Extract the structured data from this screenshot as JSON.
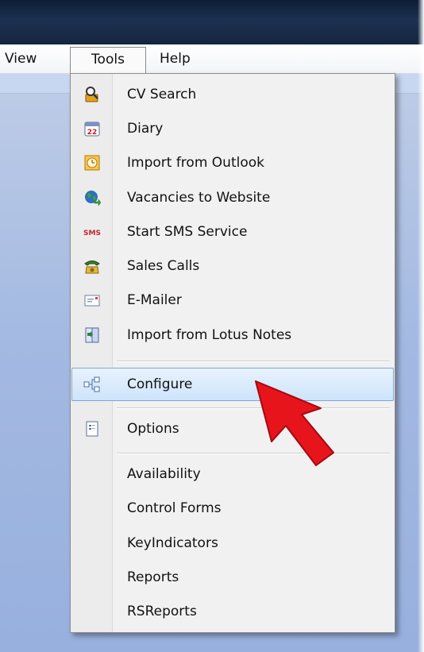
{
  "menubar": {
    "items": [
      "View",
      "Tools",
      "Help"
    ]
  },
  "tools_menu": {
    "items": [
      {
        "label": "CV Search",
        "icon": "cv-search-icon"
      },
      {
        "label": "Diary",
        "icon": "calendar-icon"
      },
      {
        "label": "Import from Outlook",
        "icon": "outlook-clock-icon"
      },
      {
        "label": "Vacancies to Website",
        "icon": "globe-icon"
      },
      {
        "label": "Start SMS Service",
        "icon": "sms-icon"
      },
      {
        "label": "Sales Calls",
        "icon": "telephone-icon"
      },
      {
        "label": "E-Mailer",
        "icon": "envelope-icon"
      },
      {
        "label": "Import from Lotus Notes",
        "icon": "lotus-notes-icon"
      },
      {
        "label": "Configure",
        "icon": "network-config-icon",
        "highlighted": true
      },
      {
        "label": "Options",
        "icon": "options-document-icon"
      },
      {
        "label": "Availability"
      },
      {
        "label": "Control Forms"
      },
      {
        "label": "KeyIndicators"
      },
      {
        "label": "Reports"
      },
      {
        "label": "RSReports"
      }
    ]
  },
  "sms_icon_text": "SMS",
  "diary_icon_text": "22",
  "colors": {
    "highlight_fill": "#cde4fb",
    "highlight_border": "#7ea6d8",
    "arrow": "#e8141c",
    "workspace": "#a3b9e2"
  }
}
